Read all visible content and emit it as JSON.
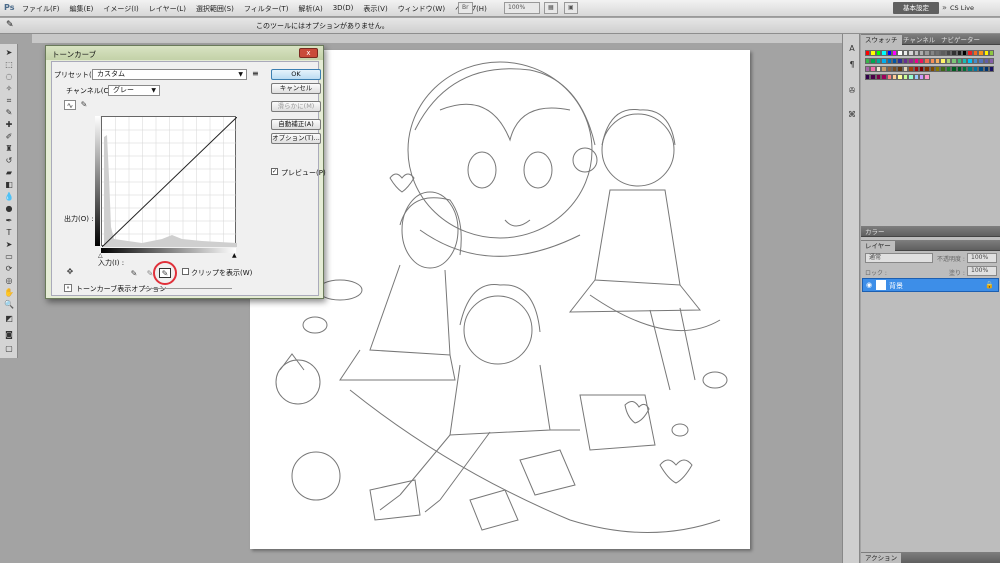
{
  "app": {
    "logo": "Ps"
  },
  "menubar": {
    "items": [
      "ファイル(F)",
      "編集(E)",
      "イメージ(I)",
      "レイヤー(L)",
      "選択範囲(S)",
      "フィルター(T)",
      "解析(A)",
      "3D(D)",
      "表示(V)",
      "ウィンドウ(W)",
      "ヘルプ(H)"
    ],
    "zoom": "100%",
    "workspace": "基本設定",
    "cs_live": "CS Live"
  },
  "options_bar": {
    "message": "このツールにはオプションがありません。"
  },
  "dialog": {
    "title": "トーンカーブ",
    "close": "x",
    "preset_label": "プリセット(R) :",
    "preset_value": "カスタム",
    "channel_label": "チャンネル(C) :",
    "channel_value": "グレー",
    "output_label": "出力(O) :",
    "input_label": "入力(I) :",
    "clip_label": "クリップを表示(W)",
    "curve_options_label": "トーンカーブ表示オプション",
    "buttons": {
      "ok": "OK",
      "cancel": "キャンセル",
      "smooth": "滑らかに(M)",
      "auto": "自動補正(A)",
      "options": "オプション(T)..."
    },
    "preview_label": "プレビュー(P)",
    "preview_checked": true
  },
  "panels": {
    "top_tabs": [
      "スウォッチ",
      "チャンネル",
      "ナビゲーター"
    ],
    "color_tab": "カラー",
    "layers_tab": "レイヤー",
    "blend_mode": "通常",
    "opacity_label": "不透明度 :",
    "opacity_value": "100%",
    "fill_label": "塗り :",
    "fill_value": "100%",
    "lock_label": "ロック :",
    "layer_name": "背景",
    "actions_tab": "アクション",
    "swatch_colors": [
      "#ff0000",
      "#ffff00",
      "#00ff00",
      "#00ffff",
      "#0000ff",
      "#ff00ff",
      "#ffffff",
      "#ebebeb",
      "#d6d6d6",
      "#c2c2c2",
      "#adadad",
      "#999999",
      "#858585",
      "#707070",
      "#5c5c5c",
      "#474747",
      "#333333",
      "#1f1f1f",
      "#000000",
      "#ee1d24",
      "#f16522",
      "#f7941d",
      "#fff200",
      "#8dc63f",
      "#39b54a",
      "#00a651",
      "#00a99d",
      "#00aeef",
      "#0072bc",
      "#0054a6",
      "#2e3192",
      "#662d91",
      "#92278f",
      "#ec008c",
      "#ed145b",
      "#f26c4f",
      "#f68e56",
      "#fbaf5d",
      "#fff467",
      "#acd372",
      "#7cc576",
      "#3bb878",
      "#1abbb4",
      "#00bff3",
      "#438cca",
      "#5574b9",
      "#605ca8",
      "#855fa8",
      "#a763a8",
      "#f06eaa",
      "#f0e6d2",
      "#c69c6d",
      "#8b5e3c",
      "#754c24",
      "#603913",
      "#ddd0b5",
      "#a0410d",
      "#9e0b0f",
      "#790000",
      "#7b2e00",
      "#7d4900",
      "#827b00",
      "#406618",
      "#197b30",
      "#005e20",
      "#005826",
      "#007236",
      "#007c7a",
      "#0076a3",
      "#004a80",
      "#003471",
      "#1b1464",
      "#32004b",
      "#4b0049",
      "#7b0046",
      "#9e005d",
      "#ff8080",
      "#ffcc99",
      "#ffff99",
      "#ccff99",
      "#99ffcc",
      "#99ccff",
      "#cc99ff",
      "#ff99cc"
    ]
  }
}
